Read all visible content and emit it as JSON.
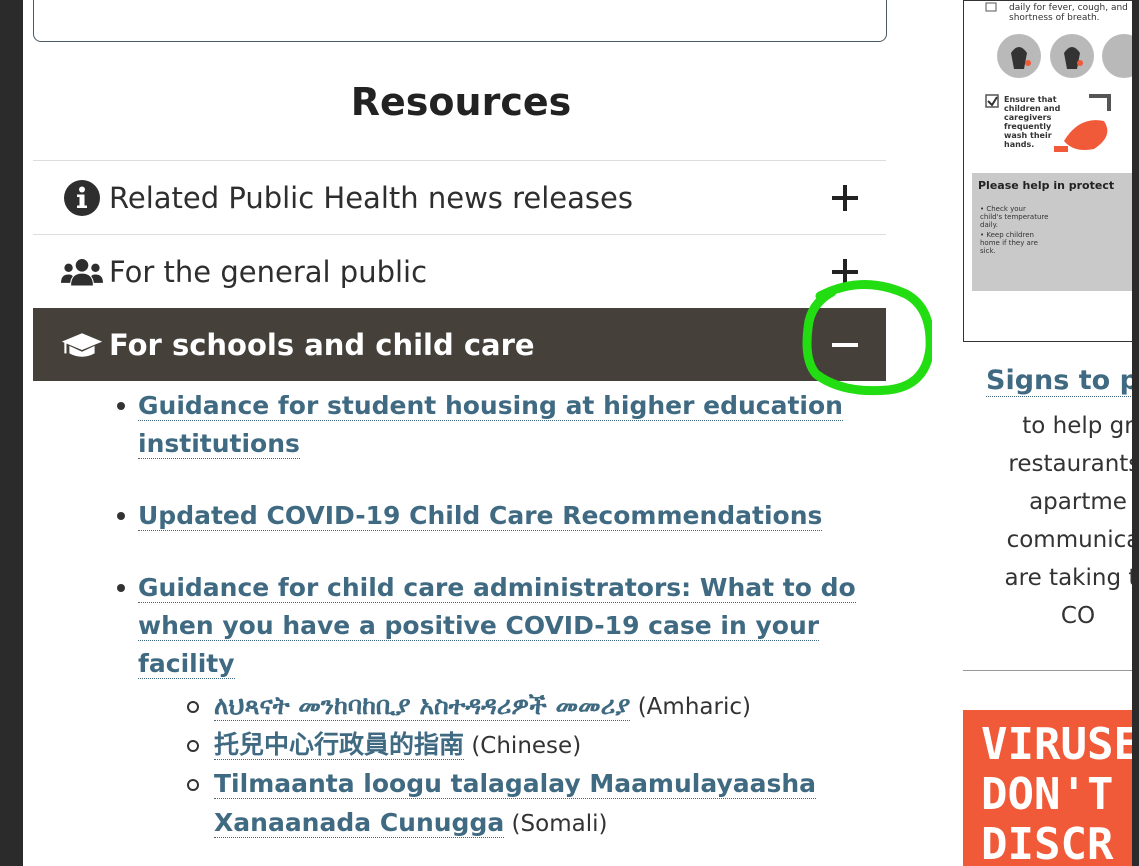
{
  "page": {
    "section_title": "Resources"
  },
  "accordion": {
    "items": [
      {
        "label": "Related Public Health news releases",
        "icon": "info-circle-icon",
        "state": "collapsed"
      },
      {
        "label": "For the general public",
        "icon": "users-icon",
        "state": "collapsed"
      },
      {
        "label": "For schools and child care",
        "icon": "graduation-cap-icon",
        "state": "expanded"
      }
    ]
  },
  "schools_links": [
    {
      "text": "Guidance for student housing at higher education institutions"
    },
    {
      "text": "Updated COVID-19 Child Care Recommendations"
    },
    {
      "text": "Guidance for child care administrators: What to do when you have a positive COVID-19 case in your facility"
    }
  ],
  "translations": [
    {
      "link": "ለህጻናት መንከባከቢያ አስተዳዳሪዎች መመሪያ",
      "lang": " (Amharic)"
    },
    {
      "link": "托兒中心行政員的指南",
      "lang": " (Chinese)"
    },
    {
      "link": "Tilmaanta loogu talagalay Maamulayaasha Xanaanada Cunugga",
      "lang": " (Somali)"
    }
  ],
  "right_column": {
    "poster": {
      "text1": "daily for fever, cough, and shortness of breath.",
      "text2": "Ensure that children and caregivers frequently wash their hands.",
      "banner": "Please help in protect",
      "bullet1": "• Check your child's temperature daily.",
      "bullet2": "• Keep children home if they are sick."
    },
    "signs_title": "Signs to p",
    "signs_desc": "to help gr\nrestaurants,\napartme\ncommunicat\nare taking to\nCO",
    "banner_text": "VIRUSE\nDON'T\nDISCR"
  },
  "colors": {
    "accent_link": "#3f6a82",
    "active_header": "#45403a",
    "annotation": "#22dd11",
    "banner": "#f05a38"
  }
}
